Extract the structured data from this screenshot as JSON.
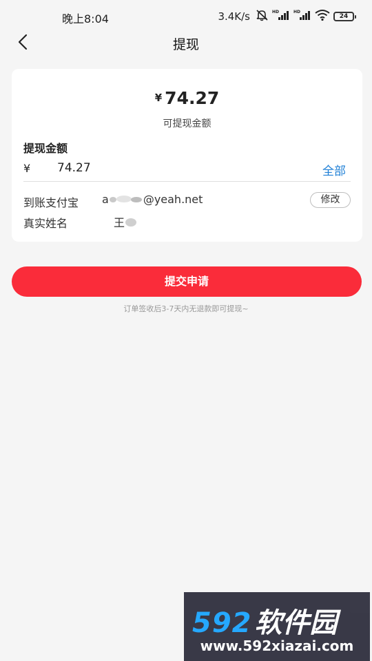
{
  "status_bar": {
    "time": "晚上8:04",
    "speed": "3.4K/s",
    "battery": "24",
    "icons": [
      "mute-bell-icon",
      "hd-signal-icon",
      "hd-signal-icon",
      "wifi-icon",
      "battery-icon"
    ]
  },
  "header": {
    "title": "提现",
    "back_icon": "chevron-left-icon"
  },
  "balance": {
    "symbol": "¥",
    "amount": "74.27",
    "caption": "可提现金额"
  },
  "withdraw": {
    "label": "提现金额",
    "symbol": "¥",
    "value": "74.27",
    "all_label": "全部"
  },
  "account": {
    "alipay_label": "到账支付宝",
    "alipay_value_prefix": "a",
    "alipay_value_suffix": "@yeah.net",
    "modify_label": "修改",
    "name_label": "真实姓名",
    "name_value": "王"
  },
  "submit_label": "提交申请",
  "note": "订单签收后3-7天内无退款即可提现~",
  "watermark": {
    "logo_num": "592",
    "logo_cn": "软件园",
    "url": "www.592xiazai.com"
  },
  "colors": {
    "accent": "#fa2c3a",
    "link": "#1e7fd6",
    "background": "#f5f5f5"
  }
}
